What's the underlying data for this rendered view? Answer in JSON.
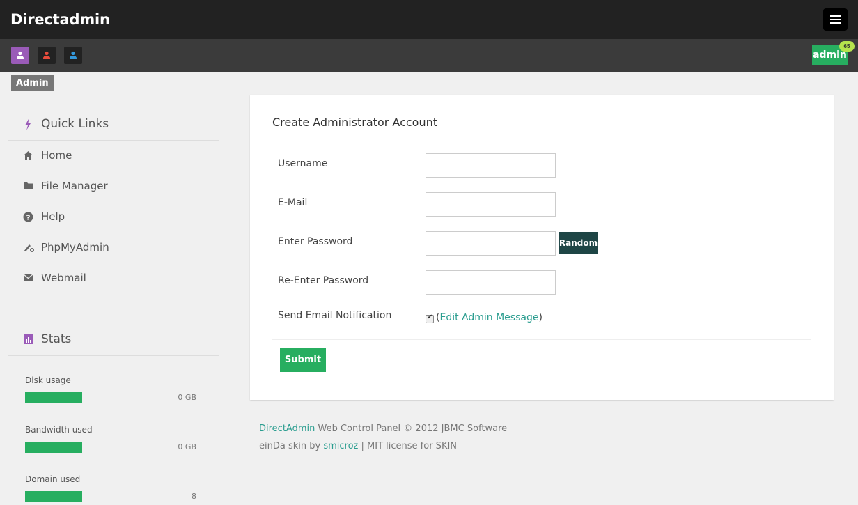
{
  "header": {
    "brand": "Directadmin"
  },
  "levels": [
    {
      "name": "admin-level",
      "color": "#ffffff"
    },
    {
      "name": "reseller-level",
      "color": "#e74c3c"
    },
    {
      "name": "user-level",
      "color": "#3498db"
    }
  ],
  "user": {
    "name": "admin",
    "badge": "65"
  },
  "level_tag": "Admin",
  "sidebar": {
    "quick_links_title": "Quick Links",
    "items": [
      {
        "label": "Home",
        "icon": "home-icon"
      },
      {
        "label": "File Manager",
        "icon": "folder-icon"
      },
      {
        "label": "Help",
        "icon": "help-icon"
      },
      {
        "label": "PhpMyAdmin",
        "icon": "phpmyadmin-icon"
      },
      {
        "label": "Webmail",
        "icon": "envelope-icon"
      }
    ],
    "stats_title": "Stats",
    "stats": [
      {
        "label": "Disk usage",
        "value": "0 GB",
        "fill": 1.0
      },
      {
        "label": "Bandwidth used",
        "value": "0 GB",
        "fill": 1.0
      },
      {
        "label": "Domain used",
        "value": "8",
        "fill": 1.0
      }
    ]
  },
  "form": {
    "title": "Create Administrator Account",
    "username_label": "Username",
    "email_label": "E-Mail",
    "password_label": "Enter Password",
    "random_label": "Random",
    "repassword_label": "Re-Enter Password",
    "notify_label": "Send Email Notification",
    "notify_checked": true,
    "edit_message_link": "Edit Admin Message",
    "submit_label": "Submit"
  },
  "footer": {
    "brand_link": "DirectAdmin",
    "line1": "Web Control Panel © 2012 JBMC Software",
    "skin_prefix": "einDa skin by",
    "skin_author": "smicroz",
    "skin_suffix": "| MIT license for SKIN"
  },
  "colors": {
    "accent_green": "#27ae60",
    "accent_purple": "#9a5bb8",
    "link_teal": "#2a9d8f",
    "random_button": "#1e4545",
    "topbar": "#222222"
  }
}
